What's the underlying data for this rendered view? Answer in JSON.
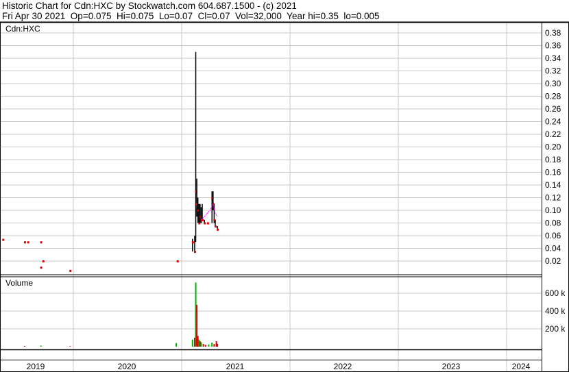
{
  "header": {
    "title": "Historic Chart for Cdn:HXC by Stockwatch.com 604.687.1500 - (c) 2021",
    "quote": "Fri Apr 30 2021  Op=0.075  Hi=0.075  Lo=0.07  Cl=0.07  Vol=32,000  Year hi=0.35  lo=0.005"
  },
  "chart_data": [
    {
      "type": "line",
      "title": "Cdn:HXC",
      "ylim": [
        0,
        0.39
      ],
      "yticks": [
        "0.38",
        "0.36",
        "0.34",
        "0.32",
        "0.30",
        "0.28",
        "0.26",
        "0.24",
        "0.22",
        "0.20",
        "0.18",
        "0.16",
        "0.14",
        "0.12",
        "0.10",
        "0.08",
        "0.06",
        "0.04",
        "0.02"
      ],
      "ytick_values": [
        0.38,
        0.36,
        0.34,
        0.32,
        0.3,
        0.28,
        0.26,
        0.24,
        0.22,
        0.2,
        0.18,
        0.16,
        0.14,
        0.12,
        0.1,
        0.08,
        0.06,
        0.04,
        0.02
      ],
      "xticks": [
        "2019",
        "2020",
        "2021",
        "2022",
        "2023",
        "2024"
      ],
      "xtick_years": [
        2019,
        2020,
        2021,
        2022,
        2023,
        2024
      ],
      "bars": [
        {
          "x": 2019.35,
          "hi": 0.054,
          "lo": 0.054,
          "cl": 0.054
        },
        {
          "x": 2019.55,
          "hi": 0.05,
          "lo": 0.05,
          "cl": 0.05
        },
        {
          "x": 2019.58,
          "hi": 0.05,
          "lo": 0.05,
          "cl": 0.05
        },
        {
          "x": 2019.7,
          "hi": 0.05,
          "lo": 0.05,
          "cl": 0.05
        },
        {
          "x": 2019.7,
          "hi": 0.01,
          "lo": 0.01,
          "cl": 0.01
        },
        {
          "x": 2019.72,
          "hi": 0.02,
          "lo": 0.02,
          "cl": 0.02
        },
        {
          "x": 2019.97,
          "hi": 0.005,
          "lo": 0.005,
          "cl": 0.005
        },
        {
          "x": 2020.96,
          "hi": 0.02,
          "lo": 0.02,
          "cl": 0.02
        },
        {
          "x": 2021.1,
          "hi": 0.055,
          "lo": 0.035,
          "cl": 0.05
        },
        {
          "x": 2021.12,
          "hi": 0.06,
          "lo": 0.035,
          "cl": 0.035
        },
        {
          "x": 2021.13,
          "hi": 0.35,
          "lo": 0.05,
          "cl": 0.13
        },
        {
          "x": 2021.14,
          "hi": 0.15,
          "lo": 0.09,
          "cl": 0.11
        },
        {
          "x": 2021.15,
          "hi": 0.12,
          "lo": 0.08,
          "cl": 0.1
        },
        {
          "x": 2021.16,
          "hi": 0.11,
          "lo": 0.078,
          "cl": 0.08
        },
        {
          "x": 2021.17,
          "hi": 0.11,
          "lo": 0.08,
          "cl": 0.09
        },
        {
          "x": 2021.18,
          "hi": 0.105,
          "lo": 0.08,
          "cl": 0.085
        },
        {
          "x": 2021.19,
          "hi": 0.11,
          "lo": 0.085,
          "cl": 0.085
        },
        {
          "x": 2021.21,
          "hi": 0.085,
          "lo": 0.08,
          "cl": 0.08
        },
        {
          "x": 2021.24,
          "hi": 0.08,
          "lo": 0.08,
          "cl": 0.08
        },
        {
          "x": 2021.28,
          "hi": 0.13,
          "lo": 0.08,
          "cl": 0.12
        },
        {
          "x": 2021.29,
          "hi": 0.13,
          "lo": 0.1,
          "cl": 0.11
        },
        {
          "x": 2021.3,
          "hi": 0.11,
          "lo": 0.08,
          "cl": 0.085
        },
        {
          "x": 2021.31,
          "hi": 0.085,
          "lo": 0.075,
          "cl": 0.075
        },
        {
          "x": 2021.33,
          "hi": 0.075,
          "lo": 0.07,
          "cl": 0.07
        }
      ],
      "moving_average": {
        "color": "#ff00ff",
        "points": [
          [
            2021.18,
            0.085
          ],
          [
            2021.22,
            0.092
          ],
          [
            2021.26,
            0.1
          ],
          [
            2021.29,
            0.11
          ],
          [
            2021.31,
            0.095
          ],
          [
            2021.33,
            0.09
          ]
        ]
      }
    },
    {
      "type": "bar",
      "title": "Volume",
      "ylim": [
        0,
        800000
      ],
      "yticks": [
        "600 k",
        "400 k",
        "200 k"
      ],
      "ytick_values": [
        600000,
        400000,
        200000
      ],
      "bars": [
        {
          "x": 2019.55,
          "v": 8000,
          "up": false
        },
        {
          "x": 2019.7,
          "v": 12000,
          "up": true
        },
        {
          "x": 2019.97,
          "v": 6000,
          "up": false
        },
        {
          "x": 2020.95,
          "v": 40000,
          "up": true
        },
        {
          "x": 2021.1,
          "v": 80000,
          "up": true
        },
        {
          "x": 2021.12,
          "v": 100000,
          "up": false
        },
        {
          "x": 2021.13,
          "v": 720000,
          "up": true
        },
        {
          "x": 2021.14,
          "v": 470000,
          "up": false
        },
        {
          "x": 2021.15,
          "v": 120000,
          "up": false
        },
        {
          "x": 2021.16,
          "v": 80000,
          "up": true
        },
        {
          "x": 2021.17,
          "v": 60000,
          "up": false
        },
        {
          "x": 2021.18,
          "v": 50000,
          "up": true
        },
        {
          "x": 2021.2,
          "v": 30000,
          "up": false
        },
        {
          "x": 2021.22,
          "v": 20000,
          "up": false
        },
        {
          "x": 2021.25,
          "v": 25000,
          "up": true
        },
        {
          "x": 2021.28,
          "v": 45000,
          "up": true
        },
        {
          "x": 2021.3,
          "v": 30000,
          "up": false
        },
        {
          "x": 2021.32,
          "v": 60000,
          "up": false
        },
        {
          "x": 2021.33,
          "v": 32000,
          "up": false
        }
      ]
    }
  ]
}
